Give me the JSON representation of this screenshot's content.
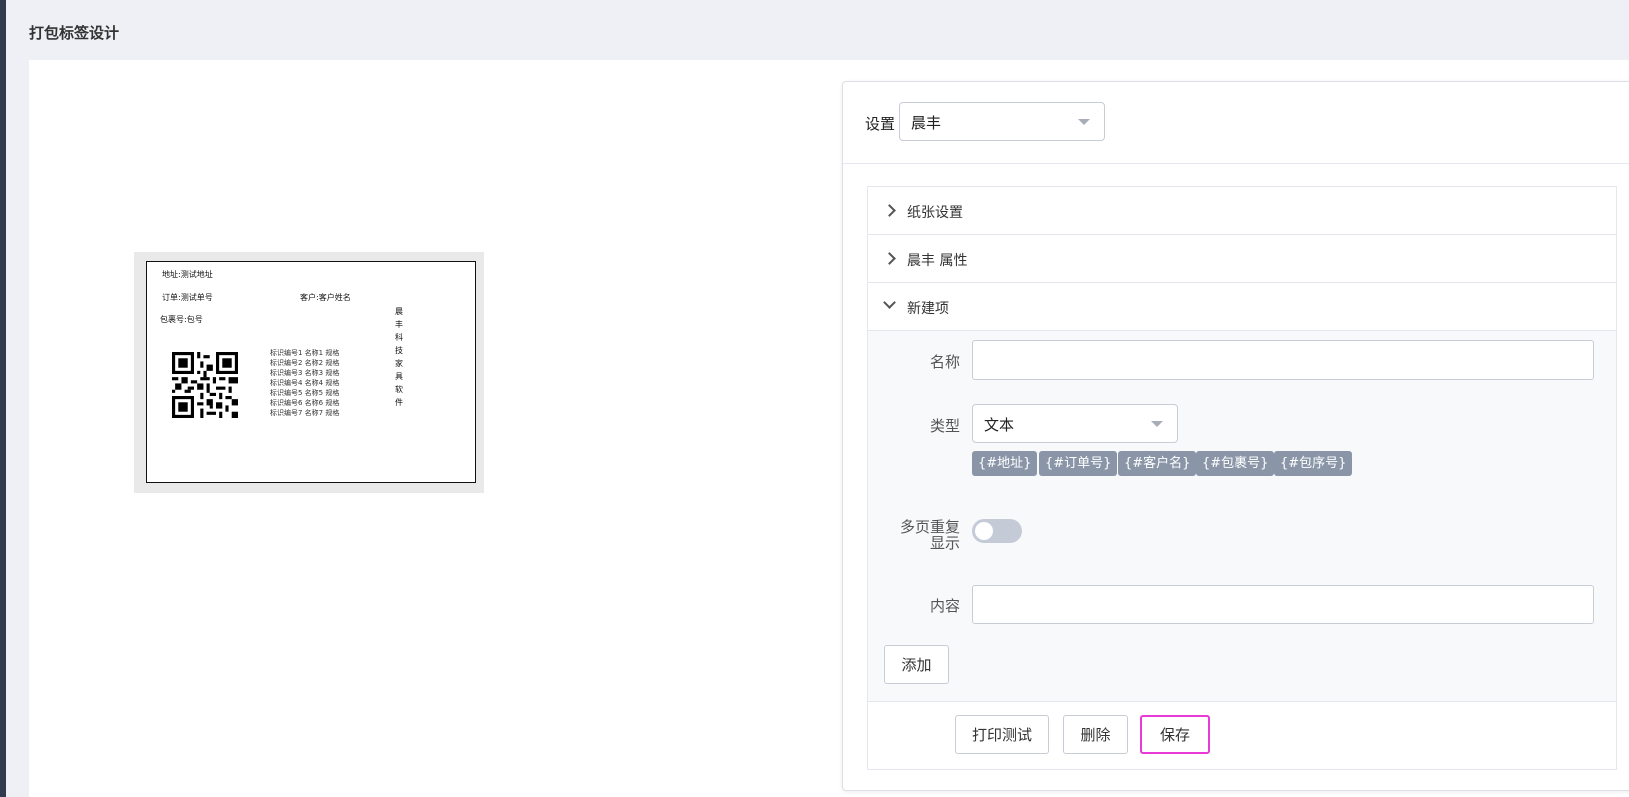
{
  "page": {
    "title": "打包标签设计"
  },
  "label_preview": {
    "address": "地址:测试地址",
    "order": "订单:测试单号",
    "customer": "客户:客户姓名",
    "package": "包裹号:包号",
    "detail_lines": [
      "标识编号1 名称1 规格",
      "标识编号2 名称2 规格",
      "标识编号3 名称3 规格",
      "标识编号4 名称4 规格",
      "标识编号5 名称5 规格",
      "标识编号6 名称6 规格",
      "标识编号7 名称7 规格"
    ],
    "vertical_chars": [
      "晨",
      "丰",
      "科",
      "技",
      "家",
      "具",
      "软",
      "件"
    ]
  },
  "settings": {
    "label": "设置",
    "selected": "晨丰"
  },
  "accordion": {
    "paper": "纸张设置",
    "properties": "晨丰 属性",
    "new_item": "新建项"
  },
  "form": {
    "name_label": "名称",
    "name_value": "",
    "type_label": "类型",
    "type_value": "文本",
    "tags": [
      "{#地址}",
      "{#订单号}",
      "{#客户名}",
      "{#包裹号}",
      "{#包序号}"
    ],
    "repeat_label_line1": "多页重复",
    "repeat_label_line2": "显示",
    "repeat_enabled": false,
    "content_label": "内容",
    "content_value": "",
    "add_button": "添加"
  },
  "actions": {
    "print_test": "打印测试",
    "delete": "删除",
    "save": "保存"
  },
  "colors": {
    "highlight": "#e83ad6",
    "tag_bg": "#8a96a8",
    "toggle_off": "#c5cbd6"
  }
}
